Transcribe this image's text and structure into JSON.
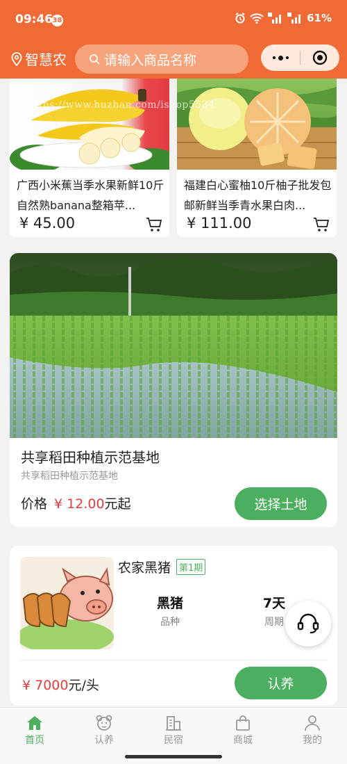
{
  "status_bar": {
    "time": "09:46",
    "notif_count": "38",
    "battery": "61%"
  },
  "header": {
    "location": "智慧农",
    "search_placeholder": "请输入商品名称"
  },
  "products": [
    {
      "title": "广西小米蕉当季水果新鲜10斤自然熟banana整箱苹...",
      "price": "¥ 45.00"
    },
    {
      "title": "福建白心蜜柚10斤柚子批发包邮新鲜当季青水果白肉...",
      "price": "¥ 111.00"
    }
  ],
  "watermark": "https://www.huzhan.com/ishop5534",
  "land": {
    "name": "共享稻田种植示范基地",
    "subtitle": "共享稻田种植示范基地",
    "price_label": "价格",
    "price": "¥ 12.00",
    "price_suffix": "元起",
    "button": "选择土地"
  },
  "adopt": {
    "title": "农家黑猪",
    "period": "第1期",
    "variety_value": "黑猪",
    "variety_label": "品种",
    "cycle_value": "7天",
    "cycle_label": "周期",
    "price": "¥ 7000",
    "unit": "元/头",
    "button": "认养"
  },
  "tabs": [
    {
      "label": "首页",
      "icon": "home-icon",
      "active": true
    },
    {
      "label": "认养",
      "icon": "bear-icon",
      "active": false
    },
    {
      "label": "民宿",
      "icon": "building-icon",
      "active": false
    },
    {
      "label": "商城",
      "icon": "bag-icon",
      "active": false
    },
    {
      "label": "我的",
      "icon": "person-icon",
      "active": false
    }
  ],
  "colors": {
    "header": "#f06a35",
    "accent": "#4caf5f",
    "price_red": "#e83a3a"
  }
}
